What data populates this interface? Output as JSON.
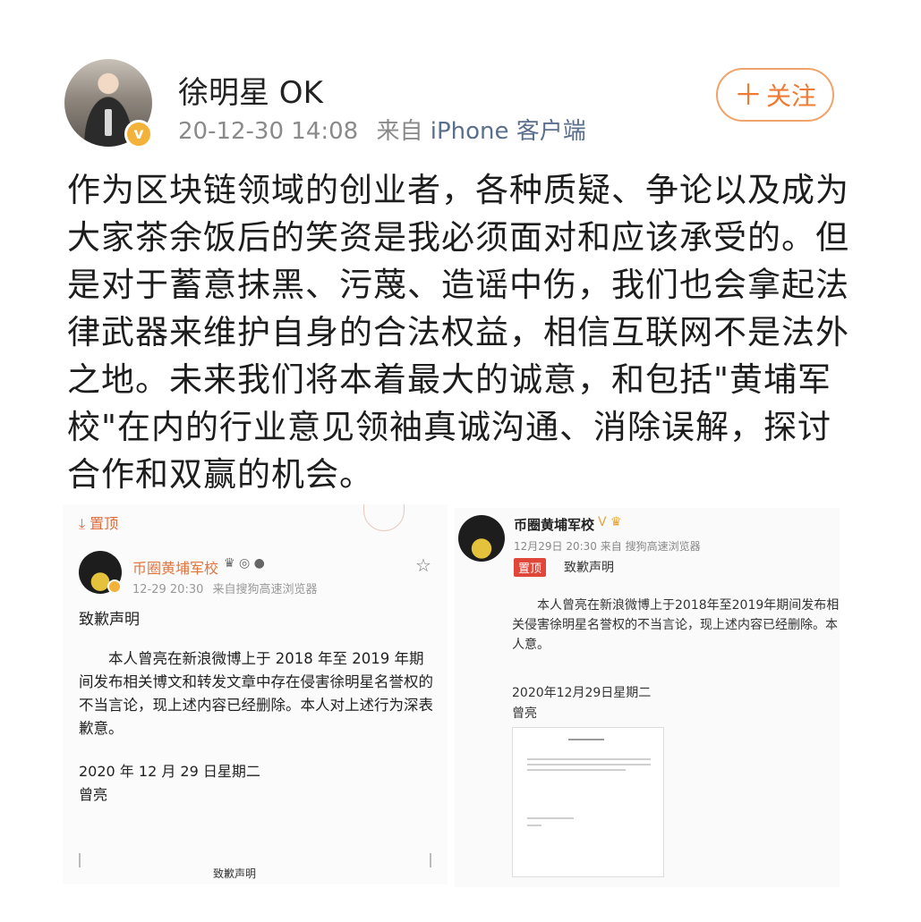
{
  "post": {
    "username": "徐明星 OK",
    "timestamp": "20-12-30 14:08",
    "source_prefix": "来自",
    "source_name": "iPhone 客户端",
    "follow_label": "关注",
    "verified_mark": "v",
    "text": "作为区块链领域的创业者，各种质疑、争论以及成为大家茶余饭后的笑资是我必须面对和应该承受的。但是对于蓄意抹黑、污蔑、造谣中伤，我们也会拿起法律武器来维护自身的合法权益，相信互联网不是法外之地。未来我们将本着最大的诚意，和包括\"黄埔军校\"在内的行业意见领袖真诚沟通、消除误解，探讨合作和双赢的机会。"
  },
  "screenshot_left": {
    "pin_label": "置顶",
    "account_name": "币圈黄埔军校",
    "timestamp": "12-29 20:30",
    "source": "来自搜狗高速浏览器",
    "title": "致歉声明",
    "body": "本人曾亮在新浪微博上于 2018 年至 2019 年期间发布相关博文和转发文章中存在侵害徐明星名誉权的不当言论，现上述内容已经删除。本人对上述行为深表歉意。",
    "date": "2020 年 12 月 29 日星期二",
    "signature": "曾亮",
    "footer": "致歉声明"
  },
  "screenshot_right": {
    "account_name": "币圈黄埔军校",
    "timestamp_source": "12月29日 20:30 来自 搜狗高速浏览器",
    "pin_label": "置顶",
    "title": "致歉声明",
    "body": "本人曾亮在新浪微博上于2018年至2019年期间发布相关侵害徐明星名誉权的不当言论，现上述内容已经删除。本人意。",
    "date": "2020年12月29日星期二",
    "signature": "曾亮"
  },
  "icons": {
    "avatar": "avatar-photo",
    "verified": "verified-badge-icon",
    "follow_plus": "plus-icon",
    "pin": "pin-icon",
    "star": "star-icon"
  },
  "colors": {
    "accent_orange": "#ef7b33",
    "source_blue": "#5a6f8e",
    "verified_gold": "#f3b23a",
    "pin_red": "#e0473a"
  }
}
